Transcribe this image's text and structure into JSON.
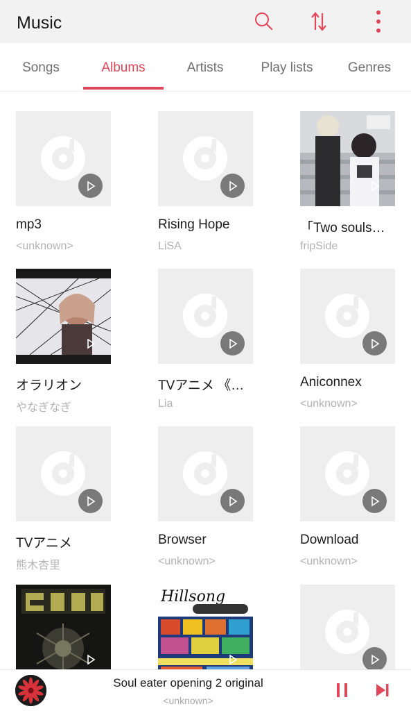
{
  "header": {
    "title": "Music",
    "icons": {
      "search": "search-icon",
      "sort": "sort-icon",
      "more": "more-vert-icon"
    },
    "accent_color": "#e0475a"
  },
  "tabs": [
    {
      "label": "Songs",
      "active": false
    },
    {
      "label": "Albums",
      "active": true
    },
    {
      "label": "Artists",
      "active": false
    },
    {
      "label": "Play lists",
      "active": false
    },
    {
      "label": "Genres",
      "active": false
    }
  ],
  "albums": [
    {
      "title": "mp3",
      "artist": "<unknown>",
      "has_art": false
    },
    {
      "title": "Rising Hope",
      "artist": "LiSA",
      "has_art": false
    },
    {
      "title": "「Two souls…",
      "artist": "fripSide",
      "has_art": true
    },
    {
      "title": "オラリオン",
      "artist": "やなぎなぎ",
      "has_art": true
    },
    {
      "title": "TVアニメ 《…",
      "artist": "Lia",
      "has_art": false
    },
    {
      "title": "Aniconnex",
      "artist": "<unknown>",
      "has_art": false
    },
    {
      "title": "TVアニメ",
      "artist": "熊木杏里",
      "has_art": false
    },
    {
      "title": "Browser",
      "artist": "<unknown>",
      "has_art": false
    },
    {
      "title": "Download",
      "artist": "<unknown>",
      "has_art": false
    },
    {
      "title": "",
      "artist": "",
      "has_art": true
    },
    {
      "title": "",
      "artist": "",
      "has_art": true
    },
    {
      "title": "",
      "artist": "",
      "has_art": false
    }
  ],
  "now_playing": {
    "title": "Soul eater opening 2 original",
    "artist": "<unknown>",
    "state": "playing"
  }
}
